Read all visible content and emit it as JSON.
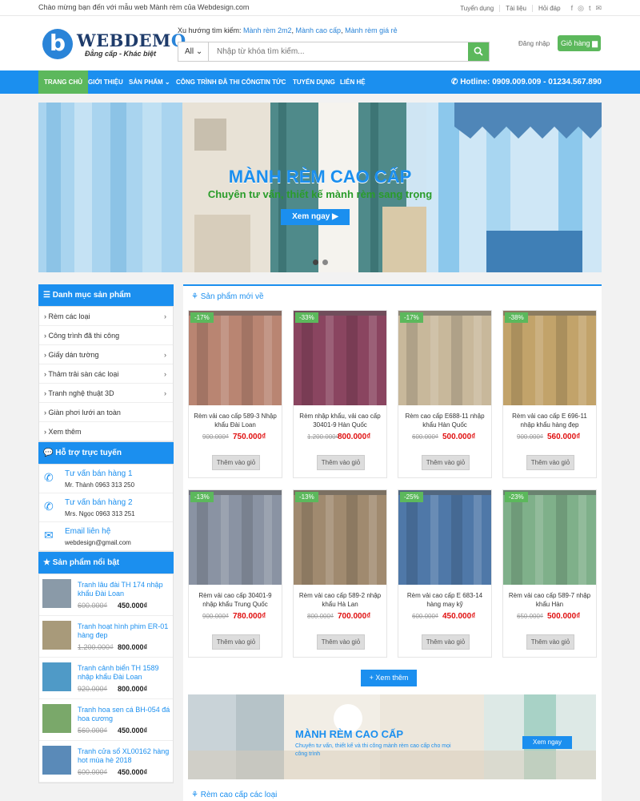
{
  "topbar": {
    "welcome": "Chào mừng bạn đến với mẫu web Mành rèm của Webdesign.com",
    "links": [
      "Tuyển dụng",
      "Tài liệu",
      "Hỏi đáp"
    ]
  },
  "header": {
    "logo_letter": "b",
    "logo_text": "WEBDEM",
    "logo_text_o": "O",
    "slogan": "Đẳng cấp - Khác biệt",
    "trend_label": "Xu hướng tìm kiếm:",
    "trends": [
      "Mành rèm 2m2",
      "Mành cao cấp",
      "Mành rèm giá rẻ"
    ],
    "search_category": "All",
    "search_placeholder": "Nhập từ khóa tìm kiếm...",
    "login": "Đăng nhập",
    "cart": "Giỏ hàng"
  },
  "nav": {
    "items": [
      "Trang chủ",
      "Giới thiệu",
      "Sản phẩm",
      "Công trình đã thi công",
      "Tin tức",
      "Tuyển dụng",
      "Liên hệ"
    ],
    "hotline": "Hotline: 0909.009.009 - 01234.567.890"
  },
  "banner": {
    "title": "MÀNH RÈM CAO CẤP",
    "subtitle": "Chuyên tư vấn, thiết kế mành rèm sang trọng",
    "button": "Xem ngay"
  },
  "sidebar": {
    "categories_title": "Danh mục sản phẩm",
    "categories": [
      {
        "label": "Rèm các loại",
        "chev": "›"
      },
      {
        "label": "Công trình đã thi công",
        "chev": ""
      },
      {
        "label": "Giấy dán tường",
        "chev": "›"
      },
      {
        "label": "Thảm trải sàn các loại",
        "chev": "›"
      },
      {
        "label": "Tranh nghệ thuật 3D",
        "chev": "›"
      },
      {
        "label": "Giàn phơi lưới an toàn",
        "chev": ""
      },
      {
        "label": "Xem thêm",
        "chev": ""
      }
    ],
    "support_title": "Hỗ trợ trực tuyến",
    "support": [
      {
        "title": "Tư vấn bán hàng 1",
        "detail": "Mr. Thành 0963 313 250"
      },
      {
        "title": "Tư vấn bán hàng 2",
        "detail": "Mrs. Ngọc 0963 313 251"
      },
      {
        "title": "Email liên hệ",
        "detail": "webdesign@gmail.com"
      }
    ],
    "featured_title": "Sản phẩm nổi bật",
    "featured": [
      {
        "name": "Tranh lâu đài TH 174 nhập khẩu Đài Loan",
        "old": "600.000₫",
        "new": "450.000₫"
      },
      {
        "name": "Tranh hoạt hình phim ER-01 hàng đẹp",
        "old": "1.200.000₫",
        "new": "800.000₫"
      },
      {
        "name": "Tranh cảnh biển TH 1589 nhập khẩu Đài Loan",
        "old": "920.000₫",
        "new": "800.000₫"
      },
      {
        "name": "Tranh hoa sen cá BH-054 đá hoa cương",
        "old": "560.000₫",
        "new": "450.000₫"
      },
      {
        "name": "Tranh cửa sổ XL00162 hàng hot mùa hè 2018",
        "old": "600.000₫",
        "new": "450.000₫"
      }
    ]
  },
  "main": {
    "new_products_title": "Sản phẩm mới về",
    "add_label": "Thêm vào giỏ",
    "products": [
      {
        "badge": "-17%",
        "name": "Rèm vải cao cấp 589-3 Nhập khẩu Đài Loan",
        "old": "900.000₫",
        "new": "750.000₫",
        "color": "#b98572"
      },
      {
        "badge": "-33%",
        "name": "Rèm nhập khẩu, vải cao cấp 30401-9 Hàn Quốc",
        "old": "1.200.000₫",
        "new": "800.000₫",
        "color": "#8a4560"
      },
      {
        "badge": "-17%",
        "name": "Rèm cao cấp E688-11 nhập khẩu Hàn Quốc",
        "old": "600.000₫",
        "new": "500.000₫",
        "color": "#c8b89b"
      },
      {
        "badge": "-38%",
        "name": "Rèm vải cao cấp E 696-11 nhập khẩu hàng đẹp",
        "old": "900.000₫",
        "new": "560.000₫",
        "color": "#c2a36a"
      },
      {
        "badge": "-13%",
        "name": "Rèm vải cao cấp 30401-9 nhập khẩu Trung Quốc",
        "old": "900.000₫",
        "new": "780.000₫",
        "color": "#8a93a3"
      },
      {
        "badge": "-13%",
        "name": "Rèm vải cao cấp 589-2 nhập khẩu Hà Lan",
        "old": "800.000₫",
        "new": "700.000₫",
        "color": "#a08a6f"
      },
      {
        "badge": "-25%",
        "name": "Rèm vải cao cấp E 683-14 hàng may kỹ",
        "old": "600.000₫",
        "new": "450.000₫",
        "color": "#4f78a8"
      },
      {
        "badge": "-23%",
        "name": "Rèm vải cao cấp 589-7 nhập khẩu Hàn",
        "old": "650.000₫",
        "new": "500.000₫",
        "color": "#7fb08a"
      }
    ],
    "more": "+ Xem thêm",
    "banner2_title": "MÀNH RÈM CAO CẤP",
    "banner2_sub": "Chuyên tư vấn, thiết kế và thi công mành rèm cao cấp cho mọi công trình",
    "banner2_btn": "Xem ngay",
    "curtains_title": "Rèm cao cấp các loại"
  }
}
